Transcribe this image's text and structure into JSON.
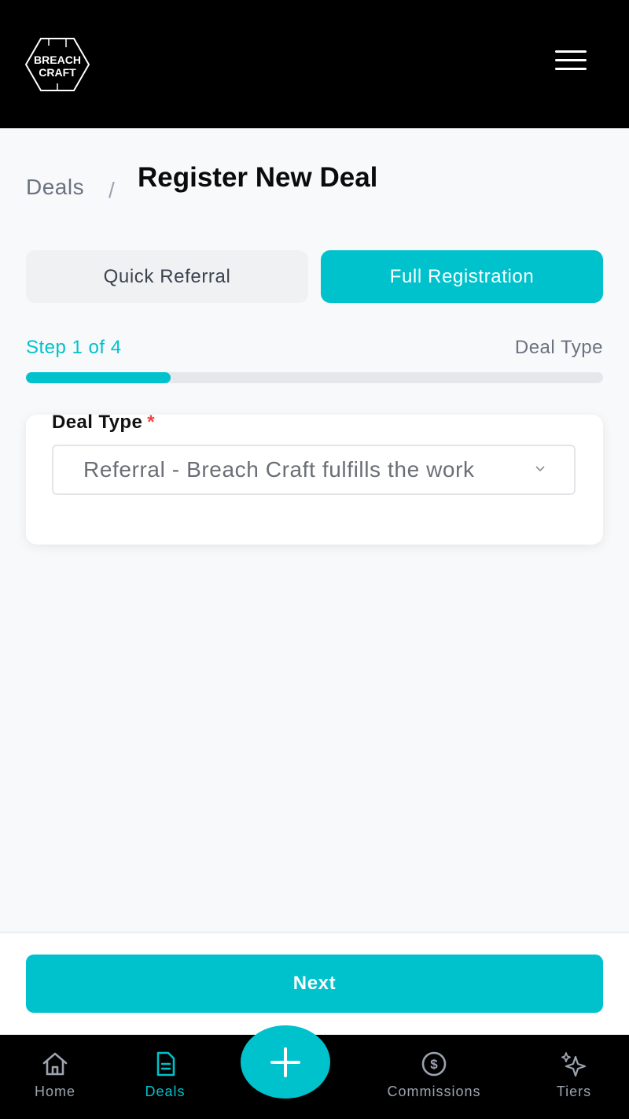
{
  "header": {
    "logo_line1": "BREACH",
    "logo_line2": "CRAFT"
  },
  "breadcrumb": {
    "parent": "Deals",
    "separator": "/",
    "title": "Register New Deal"
  },
  "tabs": [
    {
      "label": "Quick Referral",
      "active": false
    },
    {
      "label": "Full Registration",
      "active": true
    }
  ],
  "progress": {
    "step_label": "Step 1 of 4",
    "step_name": "Deal Type",
    "current": 1,
    "total": 4,
    "fraction": 0.25
  },
  "form": {
    "deal_type_label": "Deal Type",
    "required_mark": "*",
    "deal_type_value": "Referral - Breach Craft fulfills the work"
  },
  "actions": {
    "next_label": "Next"
  },
  "nav": {
    "items": [
      {
        "label": "Home",
        "icon": "home-icon",
        "active": false
      },
      {
        "label": "Deals",
        "icon": "document-icon",
        "active": true
      },
      {
        "label": "Commissions",
        "icon": "dollar-circle-icon",
        "active": false
      },
      {
        "label": "Tiers",
        "icon": "sparkles-icon",
        "active": false
      }
    ],
    "fab_icon": "plus-icon"
  },
  "colors": {
    "accent": "#00c2cc",
    "header_bg": "#000000",
    "required": "#ef4444"
  }
}
